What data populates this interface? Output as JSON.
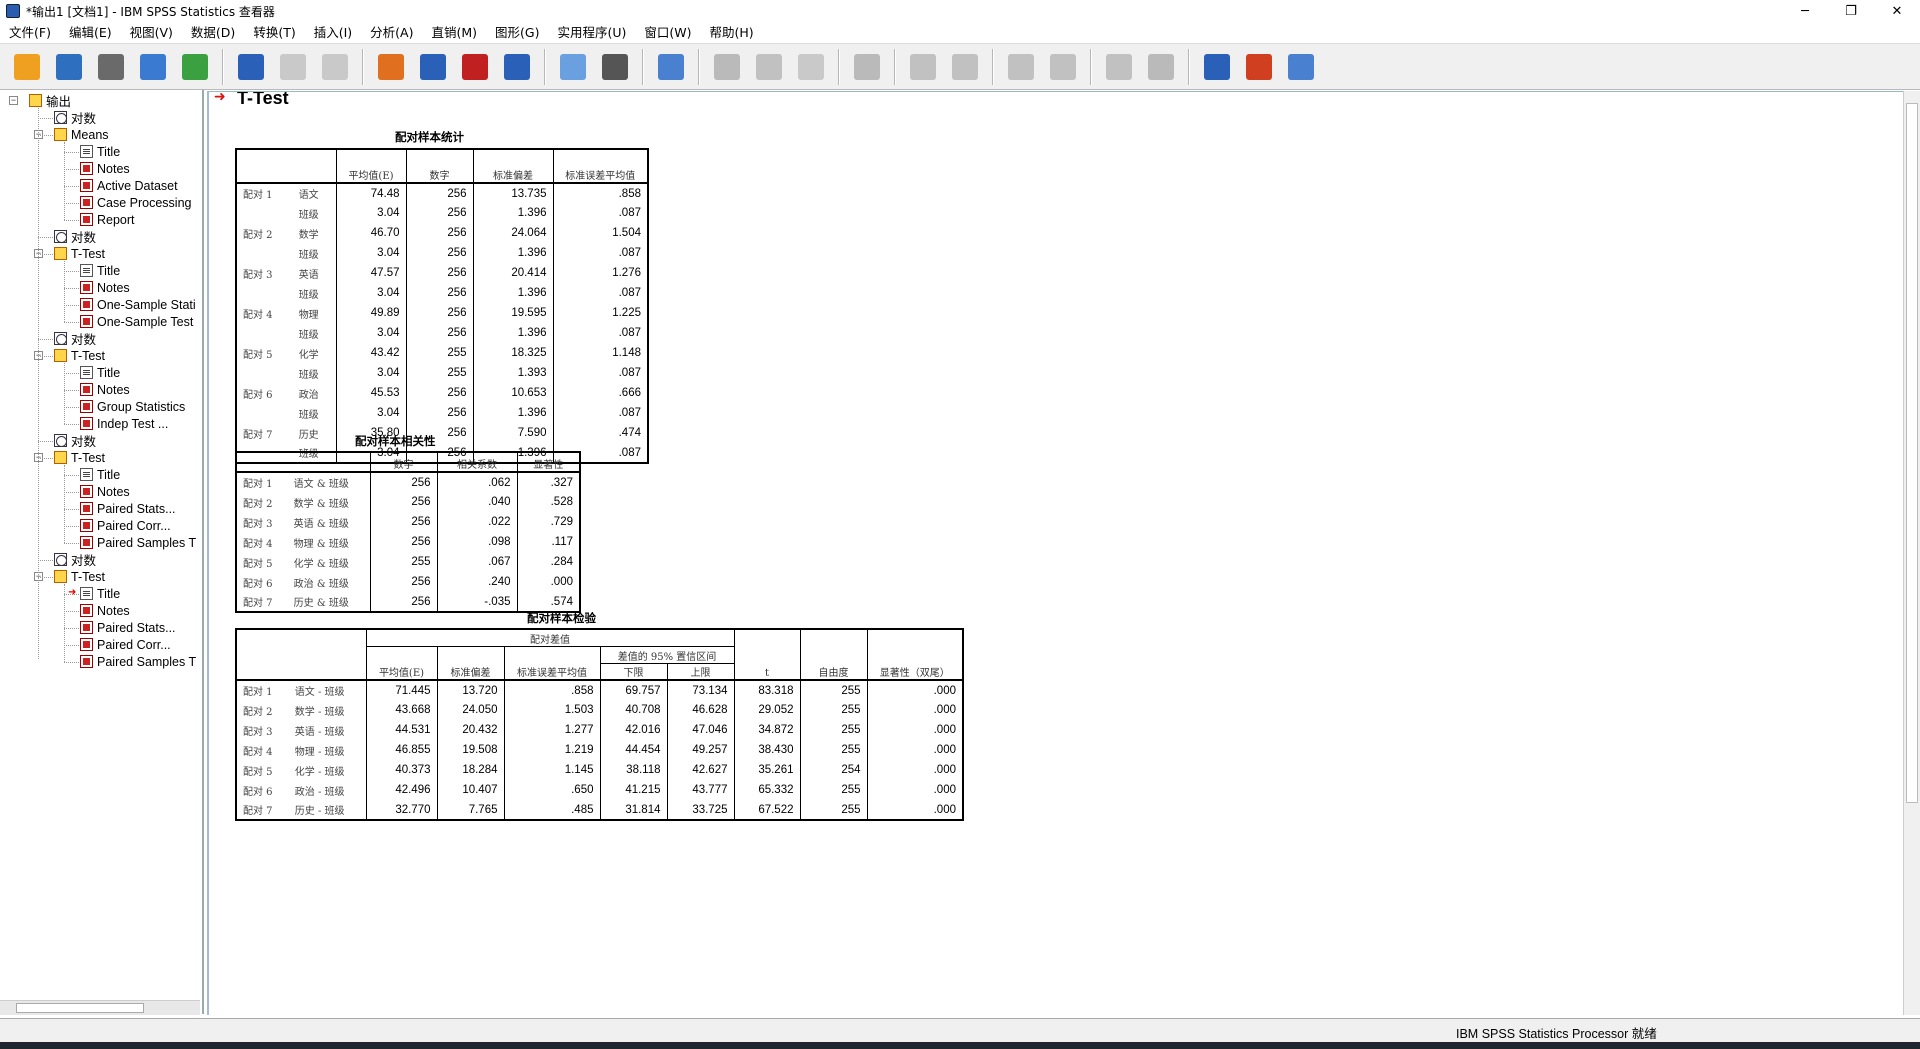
{
  "window": {
    "title": "*输出1 [文档1] - IBM SPSS Statistics 查看器",
    "min": "─",
    "max": "❐",
    "close": "✕"
  },
  "menu": [
    "文件(F)",
    "编辑(E)",
    "视图(V)",
    "数据(D)",
    "转换(T)",
    "插入(I)",
    "分析(A)",
    "直销(M)",
    "图形(G)",
    "实用程序(U)",
    "窗口(W)",
    "帮助(H)"
  ],
  "toolbar_icons": [
    "open-folder-icon",
    "save-icon",
    "print-icon",
    "print-preview-icon",
    "export-icon",
    "sep",
    "goto-data-icon",
    "undo-icon",
    "redo-icon",
    "sep",
    "goto-case-icon",
    "goto-variable-icon",
    "insert-output-icon",
    "insert-table-icon",
    "sep",
    "select-icon",
    "select-2-icon",
    "sep",
    "designate-window-icon",
    "sep",
    "pivot-icon",
    "pivot-2-icon",
    "pivot-3-icon",
    "sep",
    "hide-icon",
    "sep",
    "back-icon",
    "forward-icon",
    "sep",
    "expand-icon",
    "collapse-icon",
    "sep",
    "show-icon",
    "hide-2-icon",
    "sep",
    "insert-heading-icon",
    "insert-title-icon",
    "insert-text-icon"
  ],
  "tree": [
    {
      "label": "输出",
      "level": 0,
      "icon": "book"
    },
    {
      "label": "对数",
      "level": 1,
      "icon": "log"
    },
    {
      "label": "Means",
      "level": 1,
      "icon": "book"
    },
    {
      "label": "Title",
      "level": 2,
      "icon": "txt"
    },
    {
      "label": "Notes",
      "level": 2,
      "icon": "tbl"
    },
    {
      "label": "Active Dataset",
      "level": 2,
      "icon": "tbl"
    },
    {
      "label": "Case Processing",
      "level": 2,
      "icon": "tbl"
    },
    {
      "label": "Report",
      "level": 2,
      "icon": "tbl"
    },
    {
      "label": "对数",
      "level": 1,
      "icon": "log"
    },
    {
      "label": "T-Test",
      "level": 1,
      "icon": "book"
    },
    {
      "label": "Title",
      "level": 2,
      "icon": "txt"
    },
    {
      "label": "Notes",
      "level": 2,
      "icon": "tbl"
    },
    {
      "label": "One-Sample Stati",
      "level": 2,
      "icon": "tbl"
    },
    {
      "label": "One-Sample Test",
      "level": 2,
      "icon": "tbl"
    },
    {
      "label": "对数",
      "level": 1,
      "icon": "log"
    },
    {
      "label": "T-Test",
      "level": 1,
      "icon": "book"
    },
    {
      "label": "Title",
      "level": 2,
      "icon": "txt"
    },
    {
      "label": "Notes",
      "level": 2,
      "icon": "tbl"
    },
    {
      "label": "Group Statistics",
      "level": 2,
      "icon": "tbl"
    },
    {
      "label": "Indep Test ...",
      "level": 2,
      "icon": "tbl"
    },
    {
      "label": "对数",
      "level": 1,
      "icon": "log"
    },
    {
      "label": "T-Test",
      "level": 1,
      "icon": "book"
    },
    {
      "label": "Title",
      "level": 2,
      "icon": "txt"
    },
    {
      "label": "Notes",
      "level": 2,
      "icon": "tbl"
    },
    {
      "label": "Paired Stats...",
      "level": 2,
      "icon": "tbl"
    },
    {
      "label": "Paired Corr...",
      "level": 2,
      "icon": "tbl"
    },
    {
      "label": "Paired Samples T",
      "level": 2,
      "icon": "tbl"
    },
    {
      "label": "对数",
      "level": 1,
      "icon": "log"
    },
    {
      "label": "T-Test",
      "level": 1,
      "icon": "book"
    },
    {
      "label": "Title",
      "level": 2,
      "icon": "txt",
      "current": true
    },
    {
      "label": "Notes",
      "level": 2,
      "icon": "tbl"
    },
    {
      "label": "Paired Stats...",
      "level": 2,
      "icon": "tbl"
    },
    {
      "label": "Paired Corr...",
      "level": 2,
      "icon": "tbl"
    },
    {
      "label": "Paired Samples T",
      "level": 2,
      "icon": "tbl"
    }
  ],
  "output": {
    "heading": "T-Test",
    "stats": {
      "caption": "配对样本统计",
      "headers": [
        "平均值(E)",
        "数字",
        "标准偏差",
        "标准误差平均值"
      ],
      "rows": [
        [
          "配对 1",
          "语文",
          "74.48",
          "256",
          "13.735",
          ".858"
        ],
        [
          "",
          "班级",
          "3.04",
          "256",
          "1.396",
          ".087"
        ],
        [
          "配对 2",
          "数学",
          "46.70",
          "256",
          "24.064",
          "1.504"
        ],
        [
          "",
          "班级",
          "3.04",
          "256",
          "1.396",
          ".087"
        ],
        [
          "配对 3",
          "英语",
          "47.57",
          "256",
          "20.414",
          "1.276"
        ],
        [
          "",
          "班级",
          "3.04",
          "256",
          "1.396",
          ".087"
        ],
        [
          "配对 4",
          "物理",
          "49.89",
          "256",
          "19.595",
          "1.225"
        ],
        [
          "",
          "班级",
          "3.04",
          "256",
          "1.396",
          ".087"
        ],
        [
          "配对 5",
          "化学",
          "43.42",
          "255",
          "18.325",
          "1.148"
        ],
        [
          "",
          "班级",
          "3.04",
          "255",
          "1.393",
          ".087"
        ],
        [
          "配对 6",
          "政治",
          "45.53",
          "256",
          "10.653",
          ".666"
        ],
        [
          "",
          "班级",
          "3.04",
          "256",
          "1.396",
          ".087"
        ],
        [
          "配对 7",
          "历史",
          "35.80",
          "256",
          "7.590",
          ".474"
        ],
        [
          "",
          "班级",
          "3.04",
          "256",
          "1.396",
          ".087"
        ]
      ]
    },
    "corr": {
      "caption": "配对样本相关性",
      "headers": [
        "数字",
        "相关系数",
        "显著性"
      ],
      "rows": [
        [
          "配对 1",
          "语文 & 班级",
          "256",
          ".062",
          ".327"
        ],
        [
          "配对 2",
          "数学 & 班级",
          "256",
          ".040",
          ".528"
        ],
        [
          "配对 3",
          "英语 & 班级",
          "256",
          ".022",
          ".729"
        ],
        [
          "配对 4",
          "物理 & 班级",
          "256",
          ".098",
          ".117"
        ],
        [
          "配对 5",
          "化学 & 班级",
          "255",
          ".067",
          ".284"
        ],
        [
          "配对 6",
          "政治 & 班级",
          "256",
          ".240",
          ".000"
        ],
        [
          "配对 7",
          "历史 & 班级",
          "256",
          "-.035",
          ".574"
        ]
      ]
    },
    "test": {
      "caption": "配对样本检验",
      "group_header": "配对差值",
      "ci_header": "差值的 95% 置信区间",
      "headers": [
        "平均值(E)",
        "标准偏差",
        "标准误差平均值",
        "下限",
        "上限",
        "t",
        "自由度",
        "显著性（双尾）"
      ],
      "rows": [
        [
          "配对 1",
          "语文 - 班级",
          "71.445",
          "13.720",
          ".858",
          "69.757",
          "73.134",
          "83.318",
          "255",
          ".000"
        ],
        [
          "配对 2",
          "数学 - 班级",
          "43.668",
          "24.050",
          "1.503",
          "40.708",
          "46.628",
          "29.052",
          "255",
          ".000"
        ],
        [
          "配对 3",
          "英语 - 班级",
          "44.531",
          "20.432",
          "1.277",
          "42.016",
          "47.046",
          "34.872",
          "255",
          ".000"
        ],
        [
          "配对 4",
          "物理 - 班级",
          "46.855",
          "19.508",
          "1.219",
          "44.454",
          "49.257",
          "38.430",
          "255",
          ".000"
        ],
        [
          "配对 5",
          "化学 - 班级",
          "40.373",
          "18.284",
          "1.145",
          "38.118",
          "42.627",
          "35.261",
          "254",
          ".000"
        ],
        [
          "配对 6",
          "政治 - 班级",
          "42.496",
          "10.407",
          ".650",
          "41.215",
          "43.777",
          "65.332",
          "255",
          ".000"
        ],
        [
          "配对 7",
          "历史 - 班级",
          "32.770",
          "7.765",
          ".485",
          "31.814",
          "33.725",
          "67.522",
          "255",
          ".000"
        ]
      ]
    }
  },
  "status": {
    "text": "IBM SPSS Statistics Processor 就绪"
  }
}
